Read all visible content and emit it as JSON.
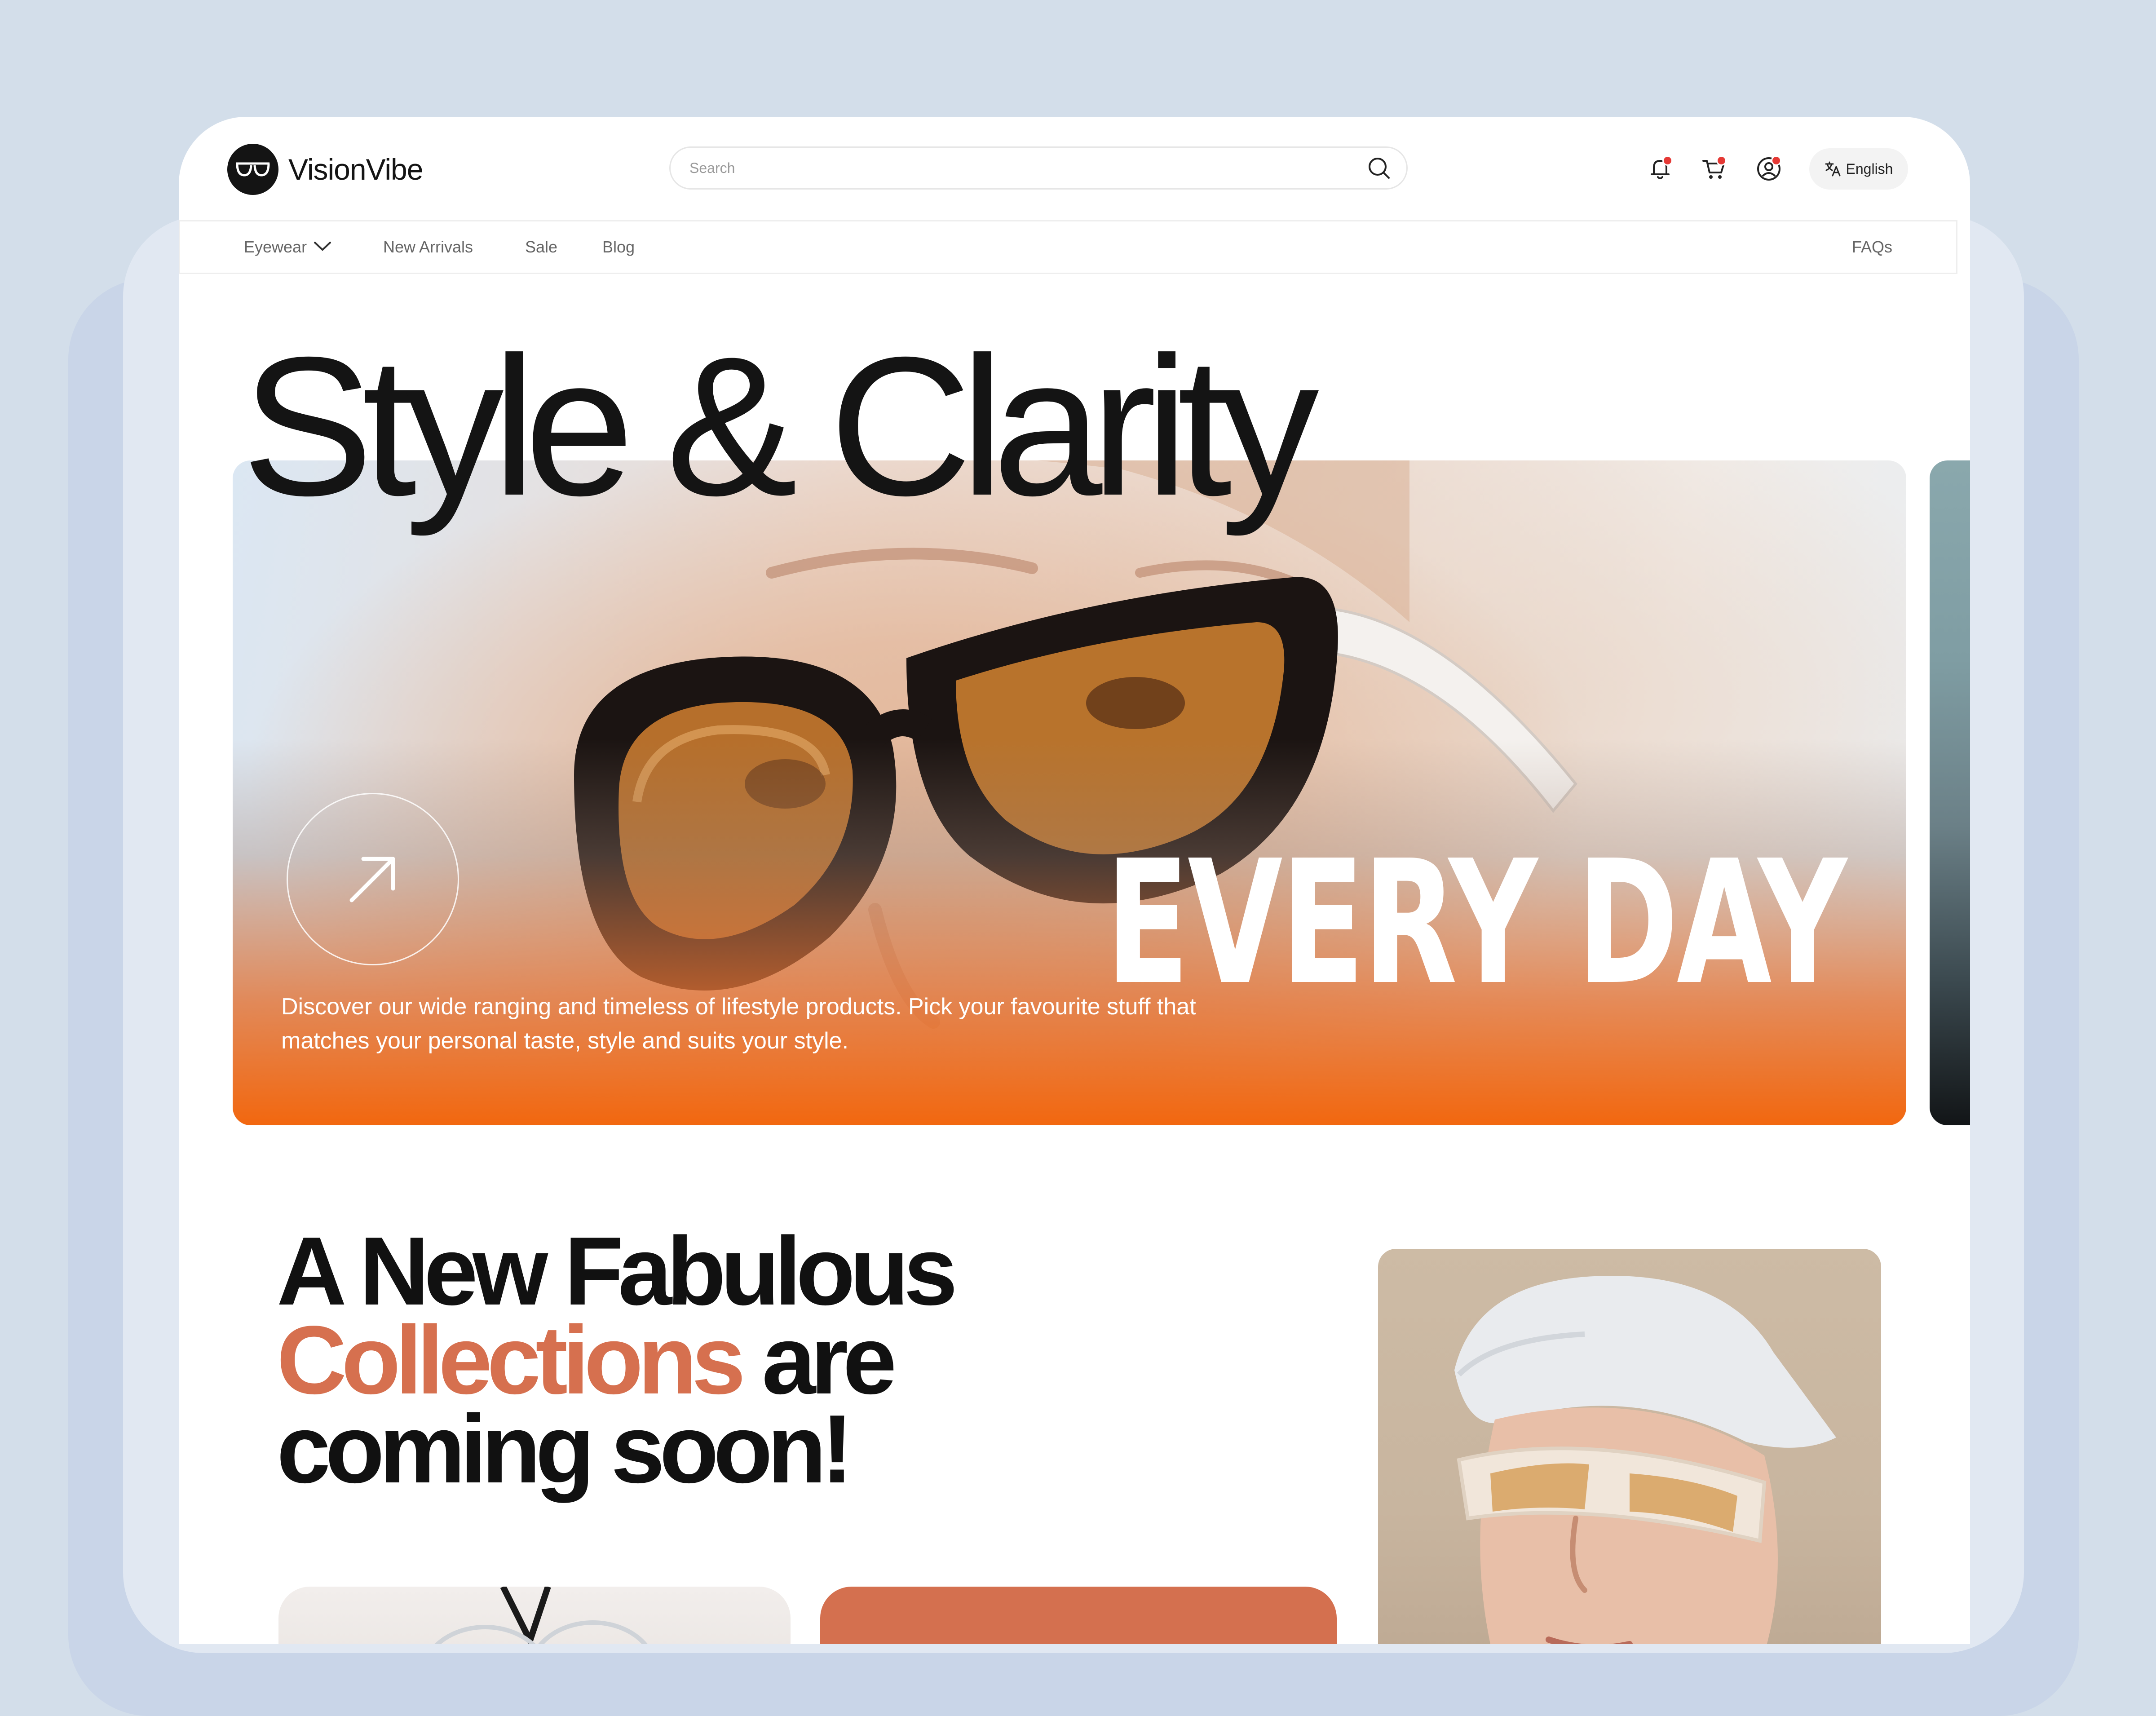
{
  "brand": {
    "name": "VisionVibe"
  },
  "header": {
    "search_placeholder": "Search",
    "language": "English"
  },
  "nav": {
    "items": [
      "Eyewear",
      "New Arrivals",
      "Sale",
      "Blog"
    ],
    "faqs": "FAQs"
  },
  "hero": {
    "title": "Style & Clarity",
    "tagline": "EVERY DAY",
    "description": "Discover our wide ranging and timeless of lifestyle products. Pick your favourite stuff that matches your personal taste, style and suits your style."
  },
  "collection": {
    "line1": "A New  Fabulous",
    "line2_accent": "Collections",
    "line2_rest": " are",
    "line3": "coming soon!"
  },
  "colors": {
    "accent": "#d6704f",
    "hero_orange": "#f2670f",
    "notification_dot": "#e53935",
    "background": "#d3deea"
  }
}
